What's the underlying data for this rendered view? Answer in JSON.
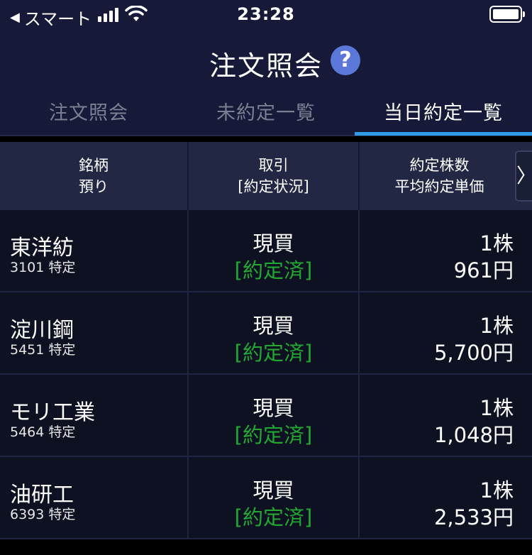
{
  "status_bar": {
    "back_label": "スマート",
    "time": "23:28"
  },
  "nav": {
    "title": "注文照会",
    "help_label": "?"
  },
  "tabs": [
    {
      "label": "注文照会",
      "active": false
    },
    {
      "label": "未約定一覧",
      "active": false
    },
    {
      "label": "当日約定一覧",
      "active": true
    }
  ],
  "table": {
    "headers": {
      "col1_line1": "銘柄",
      "col1_line2": "預り",
      "col2_line1": "取引",
      "col2_line2": "[約定状況]",
      "col3_line1": "約定株数",
      "col3_line2": "平均約定単価"
    },
    "scroll_label": "〉",
    "rows": [
      {
        "name": "東洋紡",
        "code": "3101 特定",
        "trade": "現買",
        "status": "[約定済]",
        "qty": "1株",
        "price": "961円"
      },
      {
        "name": "淀川鋼",
        "code": "5451 特定",
        "trade": "現買",
        "status": "[約定済]",
        "qty": "1株",
        "price": "5,700円"
      },
      {
        "name": "モリ工業",
        "code": "5464 特定",
        "trade": "現買",
        "status": "[約定済]",
        "qty": "1株",
        "price": "1,048円"
      },
      {
        "name": "油研工",
        "code": "6393 特定",
        "trade": "現買",
        "status": "[約定済]",
        "qty": "1株",
        "price": "2,533円"
      }
    ]
  },
  "colors": {
    "header_bg": "#161a38",
    "accent_underline": "#2e9be6",
    "status_green": "#21a832",
    "help_icon": "#5b78d8"
  }
}
